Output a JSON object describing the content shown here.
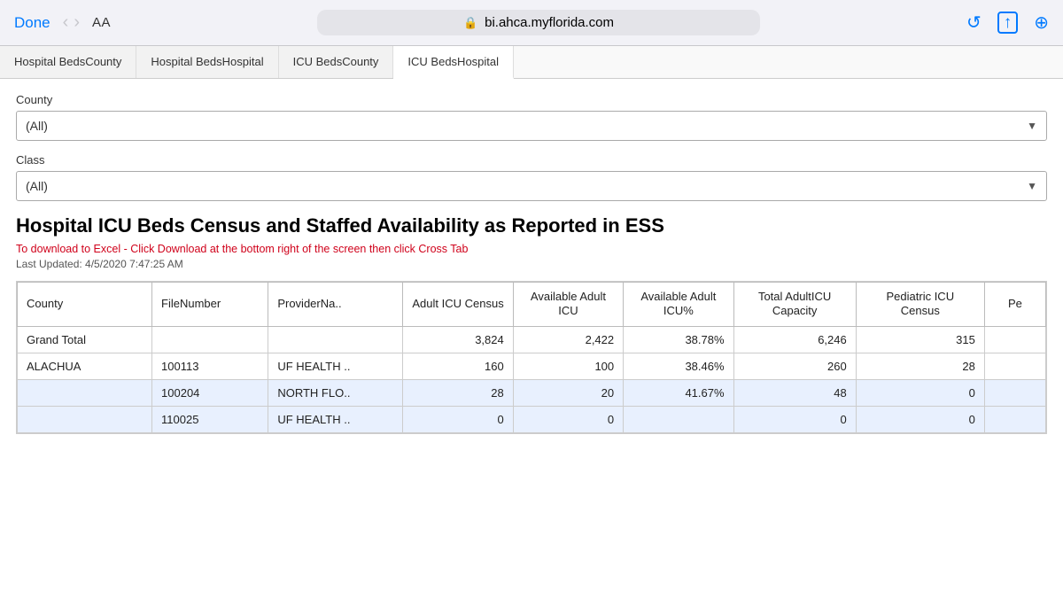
{
  "browser": {
    "done_label": "Done",
    "nav_back": "‹",
    "nav_forward": "›",
    "aa_label": "AA",
    "url": "bi.ahca.myflorida.com",
    "reload_icon": "↺",
    "share_icon": "↑",
    "compass_icon": "⊕"
  },
  "tabs": [
    {
      "id": "hosp-beds-county",
      "label": "Hospital BedsCounty",
      "active": false
    },
    {
      "id": "hosp-beds-hospital",
      "label": "Hospital BedsHospital",
      "active": false
    },
    {
      "id": "icu-beds-county",
      "label": "ICU BedsCounty",
      "active": false
    },
    {
      "id": "icu-beds-hospital",
      "label": "ICU BedsHospital",
      "active": true
    }
  ],
  "filters": {
    "county_label": "County",
    "county_value": "(All)",
    "class_label": "Class",
    "class_value": "(All)"
  },
  "report": {
    "title": "Hospital ICU Beds Census and Staffed Availability as Reported in ESS",
    "download_text": "To download to Excel - Click Download at the bottom right of the screen then click Cross Tab",
    "last_updated": "Last Updated: 4/5/2020 7:47:25 AM"
  },
  "table": {
    "headers": [
      "County",
      "FileNumber",
      "ProviderNa..",
      "Adult ICU Census",
      "Available Adult ICU",
      "Available Adult ICU%",
      "Total AdultICU Capacity",
      "Pediatric ICU Census",
      "Pe"
    ],
    "grand_total": {
      "county": "Grand Total",
      "file_number": "",
      "provider": "",
      "adult_icu_census": "3,824",
      "avail_adult_icu": "2,422",
      "avail_adult_pct": "38.78%",
      "total_adult_cap": "6,246",
      "ped_icu_census": "315",
      "pe": ""
    },
    "rows": [
      {
        "county": "ALACHUA",
        "sub_rows": [
          {
            "file_number": "100113",
            "provider": "UF HEALTH ..",
            "adult_icu_census": "160",
            "avail_adult_icu": "100",
            "avail_adult_pct": "38.46%",
            "total_adult_cap": "260",
            "ped_icu_census": "28",
            "pe": ""
          },
          {
            "file_number": "100204",
            "provider": "NORTH FLO..",
            "adult_icu_census": "28",
            "avail_adult_icu": "20",
            "avail_adult_pct": "41.67%",
            "total_adult_cap": "48",
            "ped_icu_census": "0",
            "pe": ""
          },
          {
            "file_number": "110025",
            "provider": "UF HEALTH ..",
            "adult_icu_census": "0",
            "avail_adult_icu": "0",
            "avail_adult_pct": "",
            "total_adult_cap": "0",
            "ped_icu_census": "0",
            "pe": ""
          }
        ]
      }
    ]
  }
}
